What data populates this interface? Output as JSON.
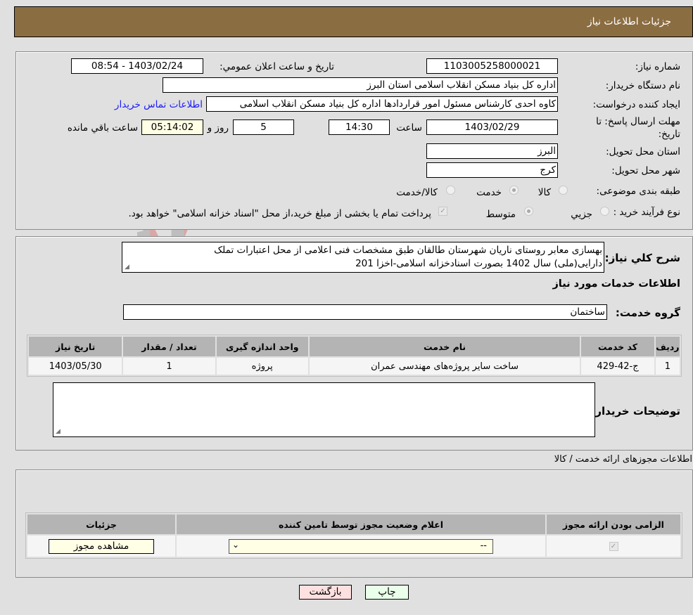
{
  "header": {
    "title": "جزئیات اطلاعات نیاز"
  },
  "form": {
    "need_number_label": "شماره نیاز:",
    "need_number": "1103005258000021",
    "announce_label": "تاریخ و ساعت اعلان عمومي:",
    "announce_value": "1403/02/24 - 08:54",
    "buyer_org_label": "نام دستگاه خريدار:",
    "buyer_org": "اداره کل بنیاد مسکن انقلاب اسلامی استان البرز",
    "creator_label": "ايجاد کننده درخواست:",
    "creator": "کاوه احدی کارشناس مسئول امور قراردادها اداره کل بنیاد مسکن انقلاب اسلامی",
    "contact_link": "اطلاعات تماس خریدار",
    "deadline_label_line1": "مهلت ارسال پاسخ: تا",
    "deadline_label_line2": "تاریخ:",
    "deadline_date": "1403/02/29",
    "time_label": "ساعت",
    "deadline_time": "14:30",
    "days_value": "5",
    "days_label": "روز و",
    "remaining_time": "05:14:02",
    "remaining_label": "ساعت باقي مانده",
    "province_label": "استان محل تحویل:",
    "province": "البرز",
    "city_label": "شهر محل تحویل:",
    "city": "کرج",
    "category_label": "طبقه بندی موضوعی:",
    "category_options": [
      "کالا",
      "خدمت",
      "کالا/خدمت"
    ],
    "category_selected": "خدمت",
    "process_label": "نوع فرآیند خرید :",
    "process_options": [
      "جزيي",
      "متوسط"
    ],
    "process_selected": "متوسط",
    "treasury_note": "پرداخت تمام یا بخشی از مبلغ خرید،از محل \"اسناد خزانه اسلامی\" خواهد بود."
  },
  "description": {
    "label": "شرح کلي نياز:",
    "text_line1": "بهسازی معابر روستای ناریان شهرستان طالقان طبق مشخصات فنی اعلامی از محل اعتبارات تملک",
    "text_line2": "دارایی(ملی)  سال 1402 بصورت اسنادخزانه اسلامی-اخزا 201"
  },
  "services": {
    "section_title": "اطلاعات خدمات مورد نياز",
    "group_label": "گروه خدمت:",
    "group_value": "ساختمان",
    "columns": [
      "رديف",
      "کد خدمت",
      "نام خدمت",
      "واحد اندازه گيری",
      "تعداد / مقدار",
      "تاريخ نياز"
    ],
    "rows": [
      {
        "index": "1",
        "code": "ج-42-429",
        "name": "ساخت سایر پروژه‌های مهندسی عمران",
        "unit": "پروژه",
        "qty": "1",
        "date": "1403/05/30"
      }
    ]
  },
  "buyer_notes": {
    "label": "توضيحات خريدار:",
    "value": ""
  },
  "permits": {
    "section_title": "اطلاعات مجوزهای ارائه خدمت / کالا",
    "columns": [
      "الزامی بودن ارائه مجوز",
      "اعلام وضعیت مجوز توسط تامین کننده",
      "جزئیات"
    ],
    "rows": [
      {
        "required": true,
        "status_selected": "--",
        "details_button": "مشاهده مجوز"
      }
    ]
  },
  "footer": {
    "print_button": "چاپ",
    "back_button": "بازگشت"
  },
  "watermark": {
    "text": "AriaTender.neT"
  },
  "colors": {
    "header_bg": "#8b6d42",
    "print_bg": "#eaffea",
    "back_bg": "#ffe0e0",
    "link": "#1a1aff"
  }
}
